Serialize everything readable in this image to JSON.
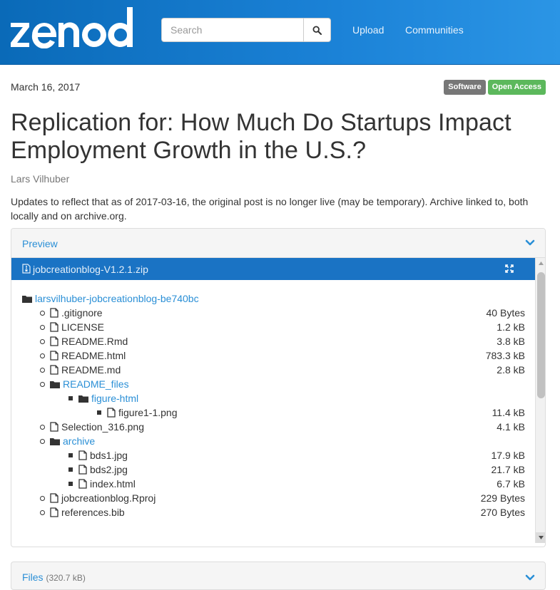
{
  "header": {
    "logo_text": "zenodo",
    "search_placeholder": "Search",
    "nav": [
      "Upload",
      "Communities"
    ]
  },
  "record": {
    "date": "March 16, 2017",
    "badges": [
      "Software",
      "Open Access"
    ],
    "title": "Replication for: How Much Do Startups Impact Employment Growth in the U.S.?",
    "author": "Lars Vilhuber",
    "description": "Updates to reflect that as of 2017-03-16, the original post is no longer live (may be temporary). Archive linked to, both locally and on archive.org."
  },
  "preview": {
    "heading": "Preview",
    "file_name": "jobcreationblog-V1.2.1.zip",
    "tree": [
      {
        "name": "larsvilhuber-jobcreationblog-be740bc",
        "type": "folder",
        "size": ""
      },
      {
        "name": ".gitignore",
        "type": "file",
        "size": "40 Bytes"
      },
      {
        "name": "LICENSE",
        "type": "file",
        "size": "1.2 kB"
      },
      {
        "name": "README.Rmd",
        "type": "file",
        "size": "3.8 kB"
      },
      {
        "name": "README.html",
        "type": "file",
        "size": "783.3 kB"
      },
      {
        "name": "README.md",
        "type": "file",
        "size": "2.8 kB"
      },
      {
        "name": "README_files",
        "type": "folder",
        "size": ""
      },
      {
        "name": "figure-html",
        "type": "folder",
        "size": ""
      },
      {
        "name": "figure1-1.png",
        "type": "file",
        "size": "11.4 kB"
      },
      {
        "name": "Selection_316.png",
        "type": "file",
        "size": "4.1 kB"
      },
      {
        "name": "archive",
        "type": "folder",
        "size": ""
      },
      {
        "name": "bds1.jpg",
        "type": "file",
        "size": "17.9 kB"
      },
      {
        "name": "bds2.jpg",
        "type": "file",
        "size": "21.7 kB"
      },
      {
        "name": "index.html",
        "type": "file",
        "size": "6.7 kB"
      },
      {
        "name": "jobcreationblog.Rproj",
        "type": "file",
        "size": "229 Bytes"
      },
      {
        "name": "references.bib",
        "type": "file",
        "size": "270 Bytes"
      }
    ]
  },
  "files": {
    "heading": "Files",
    "total": "(320.7 kB)"
  },
  "colors": {
    "brand_blue": "#1a73c4",
    "link_blue": "#2a8fd6",
    "open_access_green": "#5cb85c",
    "software_grey": "#777777"
  }
}
